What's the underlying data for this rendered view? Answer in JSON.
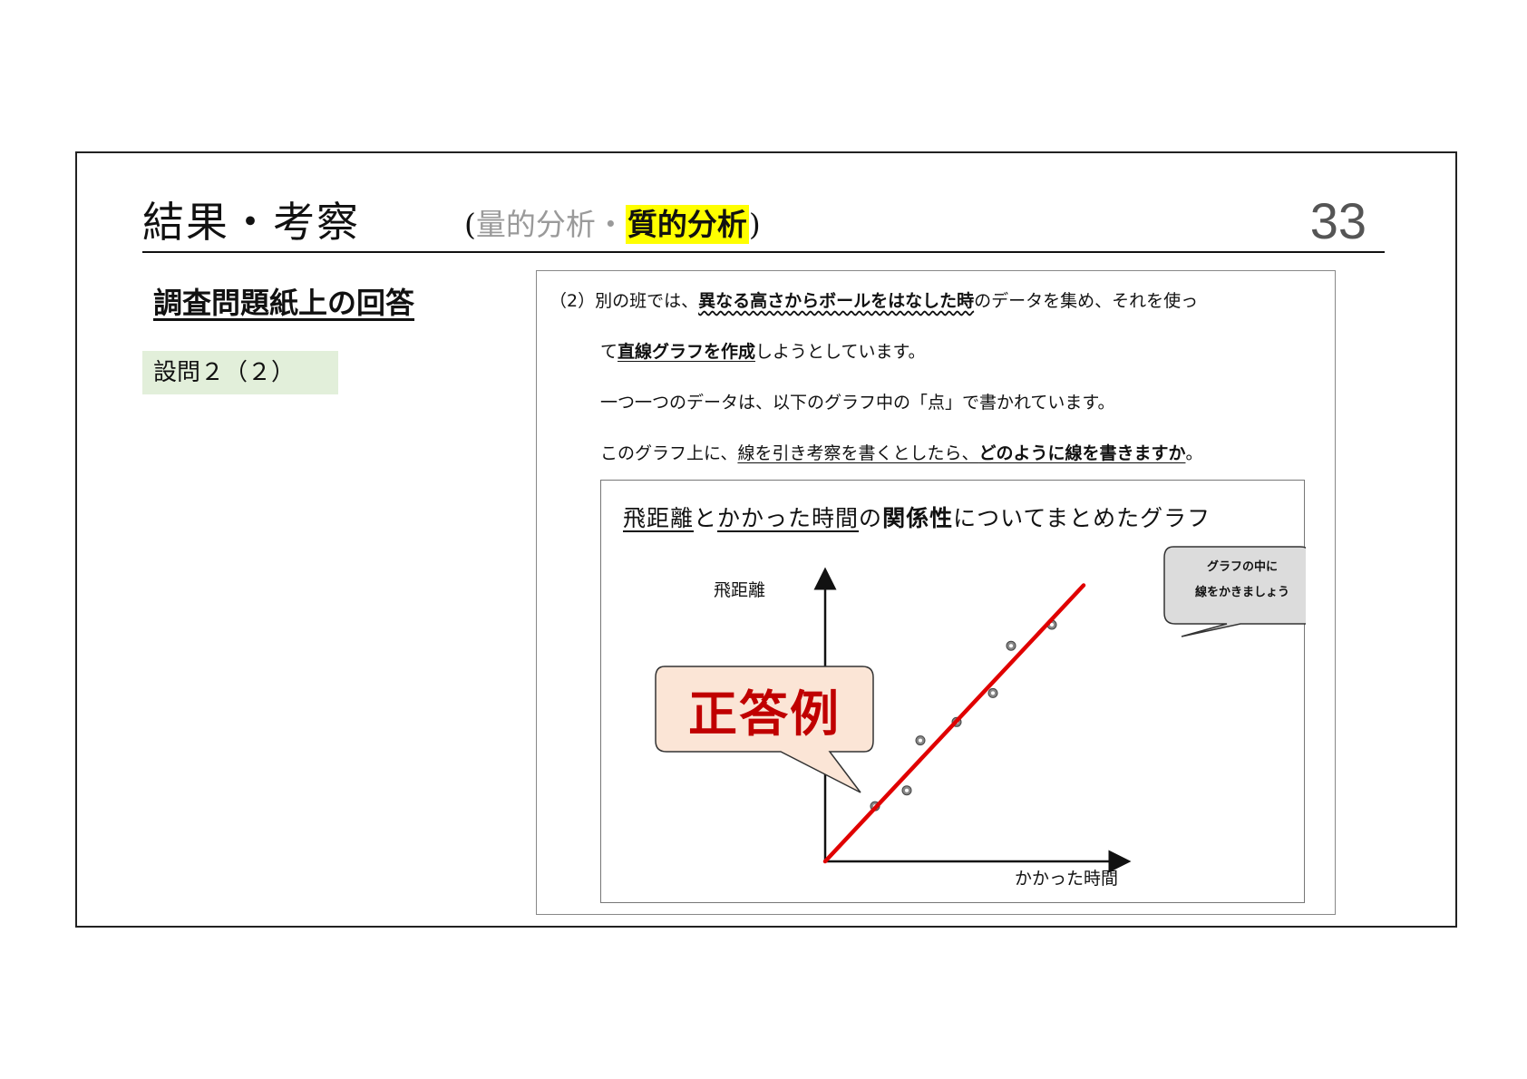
{
  "header": {
    "title_main": "結果・考察",
    "title_open": "(",
    "title_grey": "量的分析・",
    "title_highlight": "質的分析",
    "title_close": ")",
    "page_number": "33"
  },
  "left": {
    "section_title": "調査問題紙上の回答",
    "question_tag": "設問２（２）"
  },
  "question": {
    "l1_prefix": "（2）別の班では、",
    "l1_emph": "異なる高さからボールをはなした時",
    "l1_suffix": "のデータを集め、それを使っ",
    "l2_prefix": "て",
    "l2_emph": "直線グラフを作成",
    "l2_suffix": "しようとしています。",
    "l3": "一つ一つのデータは、以下のグラフ中の「点」で書かれています。",
    "l4_prefix": "このグラフ上に、",
    "l4_underline": "線を引き考察を書くとしたら、",
    "l4_emph": "どのように線を書きますか",
    "l4_suffix": "。"
  },
  "graph": {
    "title_part1": "飛距離",
    "title_part2": "と",
    "title_part3": "かかった時間",
    "title_part4": "の",
    "title_part5": "関係性",
    "title_part6": "についてまとめたグラフ",
    "y_label": "飛距離",
    "x_label": "かかった時間",
    "callout_line1": "グラフの中に",
    "callout_line2": "線をかきましょう",
    "answer_label": "正答例",
    "line_color": "#e00000",
    "answer_fill": "#fbe5d6"
  },
  "chart_data": {
    "type": "scatter",
    "xlabel": "かかった時間",
    "ylabel": "飛距離",
    "points": [
      {
        "x": 0.55,
        "y": 0.21
      },
      {
        "x": 0.9,
        "y": 0.27
      },
      {
        "x": 1.05,
        "y": 0.46
      },
      {
        "x": 1.45,
        "y": 0.53
      },
      {
        "x": 1.85,
        "y": 0.64
      },
      {
        "x": 2.05,
        "y": 0.82
      },
      {
        "x": 2.5,
        "y": 0.9
      }
    ],
    "fit_line": {
      "x": [
        0,
        2.85
      ],
      "y": [
        0,
        1.05
      ]
    },
    "xlim": [
      0,
      3.0
    ],
    "ylim": [
      0,
      1.0
    ],
    "grid": false
  }
}
